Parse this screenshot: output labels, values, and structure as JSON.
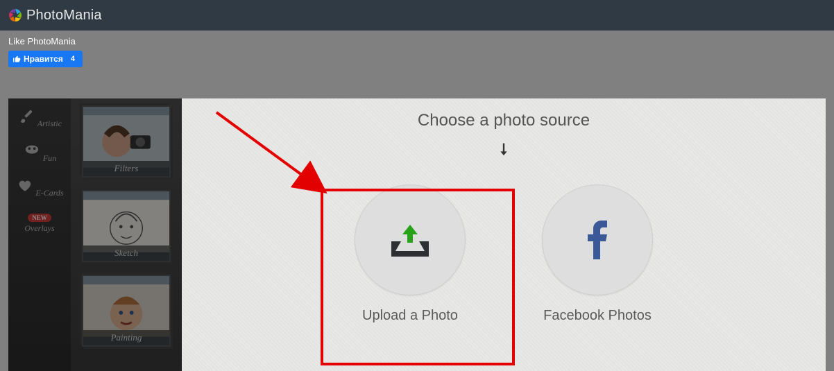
{
  "header": {
    "brand_prefix": "Photo",
    "brand_suffix": "Mania"
  },
  "like_panel": {
    "title": "Like PhotoMania",
    "button_label": "Нравится",
    "count": "4"
  },
  "sidebar": {
    "categories": [
      {
        "label": "Artistic"
      },
      {
        "label": "Fun"
      },
      {
        "label": "E-Cards"
      },
      {
        "label": "Overlays",
        "badge": "NEW"
      }
    ]
  },
  "thumbs": [
    {
      "label": "Filters"
    },
    {
      "label": "Sketch"
    },
    {
      "label": "Painting"
    }
  ],
  "choose": {
    "title": "Choose a photo source",
    "options": [
      {
        "label": "Upload a Photo"
      },
      {
        "label": "Facebook Photos"
      }
    ]
  }
}
